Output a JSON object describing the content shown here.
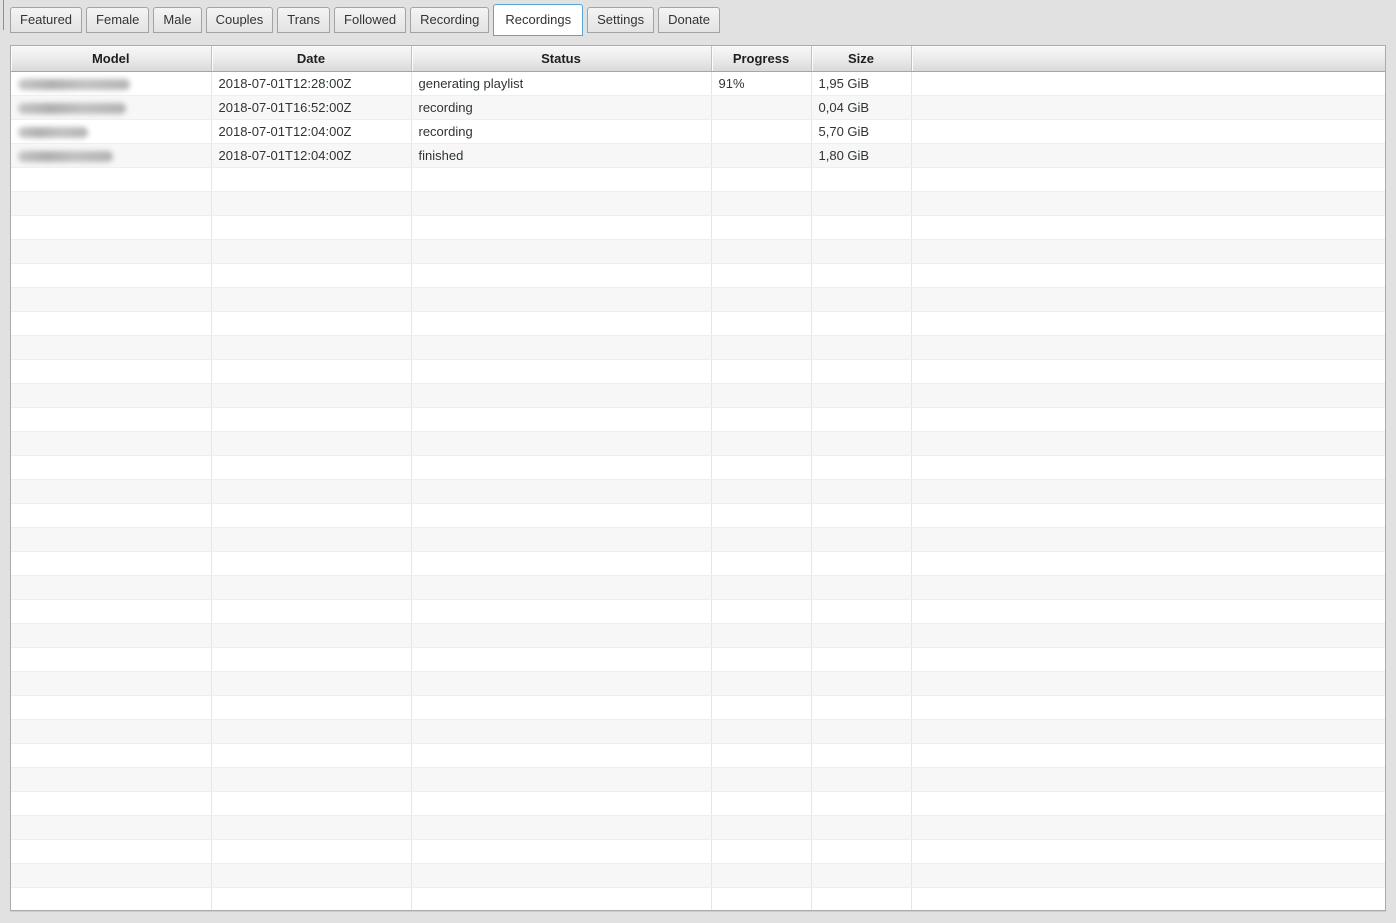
{
  "tabs": {
    "items": [
      {
        "label": "Featured",
        "selected": false
      },
      {
        "label": "Female",
        "selected": false
      },
      {
        "label": "Male",
        "selected": false
      },
      {
        "label": "Couples",
        "selected": false
      },
      {
        "label": "Trans",
        "selected": false
      },
      {
        "label": "Followed",
        "selected": false
      },
      {
        "label": "Recording",
        "selected": false
      },
      {
        "label": "Recordings",
        "selected": true
      },
      {
        "label": "Settings",
        "selected": false
      },
      {
        "label": "Donate",
        "selected": false
      }
    ]
  },
  "table": {
    "columns": [
      {
        "label": "Model"
      },
      {
        "label": "Date"
      },
      {
        "label": "Status"
      },
      {
        "label": "Progress"
      },
      {
        "label": "Size"
      },
      {
        "label": ""
      }
    ],
    "rows": [
      {
        "model_redacted": true,
        "model_blur_width": 112,
        "date": "2018-07-01T12:28:00Z",
        "status": "generating playlist",
        "progress": "91%",
        "size": "1,95 GiB"
      },
      {
        "model_redacted": true,
        "model_blur_width": 108,
        "date": "2018-07-01T16:52:00Z",
        "status": "recording",
        "progress": "",
        "size": "0,04 GiB"
      },
      {
        "model_redacted": true,
        "model_blur_width": 70,
        "date": "2018-07-01T12:04:00Z",
        "status": "recording",
        "progress": "",
        "size": "5,70 GiB"
      },
      {
        "model_redacted": true,
        "model_blur_width": 95,
        "date": "2018-07-01T12:04:00Z",
        "status": "finished",
        "progress": "",
        "size": "1,80 GiB"
      }
    ],
    "empty_row_count": 31
  },
  "colors": {
    "accent_selected_tab": "#57a3da",
    "page_background": "#e1e1e1",
    "row_stripe": "#f7f7f7",
    "table_border": "#ababab"
  }
}
